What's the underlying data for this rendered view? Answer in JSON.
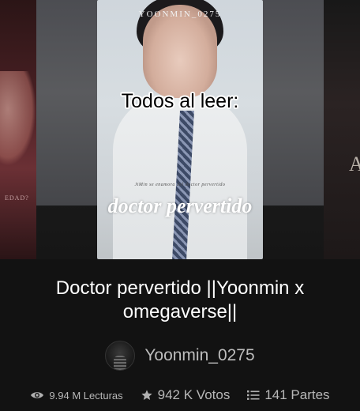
{
  "cover": {
    "handle": "YOONMIN_0275",
    "subtitle": "JiMin se enamora del doctor pervertido",
    "title": "doctor pervertido"
  },
  "side_covers": {
    "left_text": "EDAD?",
    "right_text": "A L"
  },
  "meme_caption": "Todos al leer:",
  "story": {
    "title": "Doctor pervertido ||Yoonmin x omegaverse||"
  },
  "author": {
    "name": "Yoonmin_0275"
  },
  "stats": {
    "reads": "9.94 M Lecturas",
    "votes": "942 K Votos",
    "parts": "141 Partes"
  },
  "icons": {
    "reads": "eye-icon",
    "votes": "star-icon",
    "parts": "list-icon"
  },
  "colors": {
    "background": "#121212",
    "title_text": "#ffffff",
    "muted_text": "#b0b0b0"
  }
}
